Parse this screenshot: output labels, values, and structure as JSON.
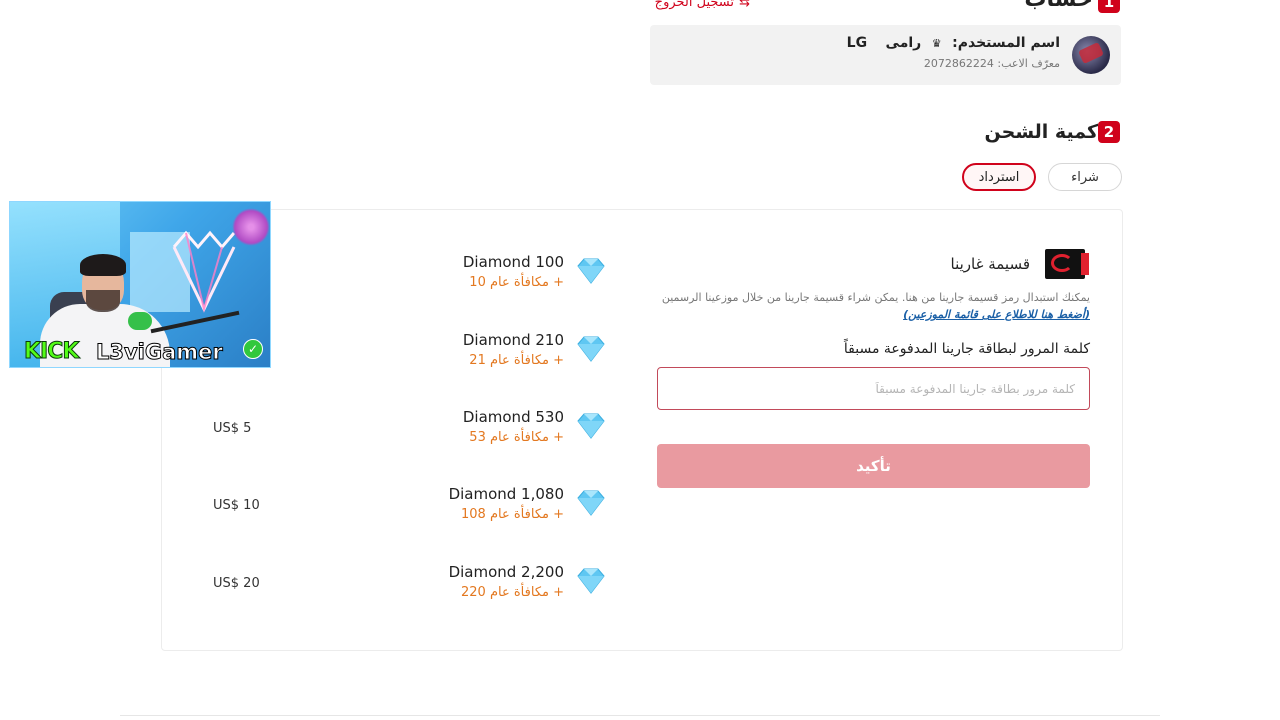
{
  "section1": {
    "number": "1",
    "title": "حساب",
    "logout_label": "تسجيل الخروج",
    "logout_icon": "logout-icon"
  },
  "account": {
    "username_label": "اسم المستخدم:",
    "username": "رامى",
    "username_suffix": "LG",
    "crown_icon": "crown-icon",
    "player_id_label": "معرّف الاعب:",
    "player_id": "2072862224"
  },
  "section2": {
    "number": "2",
    "title": "كمية الشحن",
    "tabs": [
      {
        "label": "شراء",
        "active": false
      },
      {
        "label": "استرداد",
        "active": true
      }
    ]
  },
  "redeem": {
    "title": "قسيمة غارينا",
    "description": "يمكنك استبدال رمز قسيمة جارينا من هنا. يمكن شراء قسيمة جارينا من خلال موزعينا الرسمين",
    "link_text": "(أضغط هنا للاطلاع على قائمة الموزعين)",
    "pin_label": "كلمة المرور لبطاقة جارينا المدفوعة مسبقاً",
    "pin_placeholder": "كلمة مرور بطاقة جارينا المدفوعة مسبقاً",
    "confirm_label": "تأكيد"
  },
  "packages": [
    {
      "name": "Diamond 100",
      "bonus": "+ مكافأة عام 10",
      "price": ""
    },
    {
      "name": "Diamond 210",
      "bonus": "+ مكافأة عام 21",
      "price": ""
    },
    {
      "name": "Diamond 530",
      "bonus": "+ مكافأة عام 53",
      "price": "US$ 5"
    },
    {
      "name": "Diamond 1,080",
      "bonus": "+ مكافأة عام 108",
      "price": "US$ 10"
    },
    {
      "name": "Diamond 2,200",
      "bonus": "+ مكافأة عام 220",
      "price": "US$ 20"
    }
  ],
  "stream_overlay": {
    "platform": "KICK",
    "handle": "L3viGamer",
    "verified_icon": "verified-check-icon"
  },
  "colors": {
    "accent_red": "#d0021b",
    "bonus_orange": "#e37820",
    "confirm_disabled": "#e99aa0",
    "gem_blue": "#5fc7f2"
  }
}
